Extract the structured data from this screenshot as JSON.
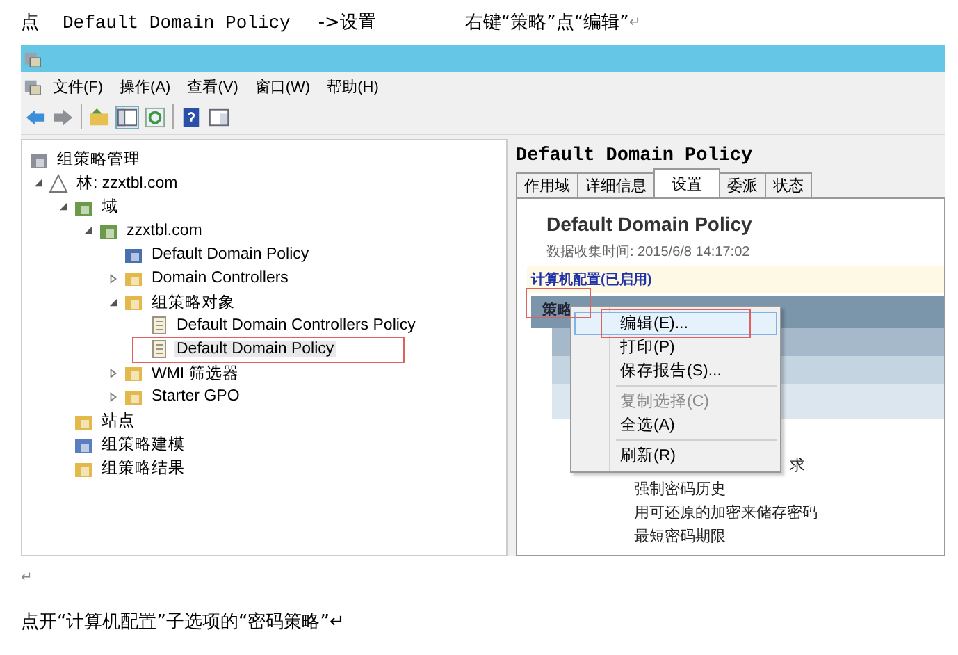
{
  "heading": [
    {
      "kind": "cjk",
      "text": "点"
    },
    {
      "kind": "mono",
      "text": "Default Domain Policy"
    },
    {
      "kind": "cjk",
      "text": "->设置"
    },
    {
      "kind": "cjk",
      "text": "右键“策略”点“编辑”"
    },
    {
      "kind": "mark",
      "text": "↵"
    }
  ],
  "menu_bar": [
    "文件(F)",
    "操作(A)",
    "查看(V)",
    "窗口(W)",
    "帮助(H)"
  ],
  "tree": [
    {
      "label": "组策略管理",
      "kind": "console",
      "children": [
        {
          "label": "林: zzxtbl.com",
          "kind": "forest",
          "expanded": true,
          "children": [
            {
              "label": "域",
              "kind": "domain",
              "expanded": true,
              "children": [
                {
                  "label": "zzxtbl.com",
                  "kind": "domain",
                  "expanded": true,
                  "children": [
                    {
                      "label": "Default Domain Policy",
                      "kind": "link"
                    },
                    {
                      "label": "Domain Controllers",
                      "kind": "folder",
                      "expanded": false
                    },
                    {
                      "label": "组策略对象",
                      "kind": "folder",
                      "expanded": true,
                      "children": [
                        {
                          "label": "Default Domain Controllers Policy",
                          "kind": "gpo",
                          "selected": false
                        },
                        {
                          "label": "Default Domain Policy",
                          "kind": "gpo",
                          "selected": true
                        }
                      ]
                    },
                    {
                      "label": "WMI 筛选器",
                      "kind": "folder",
                      "expanded": false
                    },
                    {
                      "label": "Starter GPO",
                      "kind": "folder",
                      "expanded": false
                    }
                  ]
                }
              ]
            },
            {
              "label": "站点",
              "kind": "folder"
            },
            {
              "label": "组策略建模",
              "kind": "modeling"
            },
            {
              "label": "组策略结果",
              "kind": "folder"
            }
          ]
        }
      ]
    }
  ],
  "right_pane": {
    "title": "Default Domain Policy",
    "tabs": [
      {
        "label": "作用域",
        "selected": false
      },
      {
        "label": "详细信息",
        "selected": false
      },
      {
        "label": "设置",
        "selected": true
      },
      {
        "label": "委派",
        "selected": false
      },
      {
        "label": "状态",
        "selected": false
      }
    ],
    "report_title": "Default Domain Policy",
    "collected": "数据收集时间: 2015/6/8 14:17:02",
    "section": "计算机配置(已启用)",
    "policy_bar": "策略",
    "rows": [
      "求",
      "强制密码历史",
      "用可还原的加密来储存密码",
      "最短密码期限"
    ]
  },
  "context_menu": [
    {
      "label": "编辑(E)...",
      "selected": true,
      "disabled": false
    },
    {
      "label": "打印(P)",
      "selected": false,
      "disabled": false
    },
    {
      "label": "保存报告(S)...",
      "selected": false,
      "disabled": false,
      "separator_after": true
    },
    {
      "label": "复制选择(C)",
      "selected": false,
      "disabled": true
    },
    {
      "label": "全选(A)",
      "selected": false,
      "disabled": false,
      "separator_after": true
    },
    {
      "label": "刷新(R)",
      "selected": false,
      "disabled": false
    }
  ],
  "marks": [
    "↵"
  ],
  "caption": "点开“计算机配置”子选项的“密码策略”↵"
}
